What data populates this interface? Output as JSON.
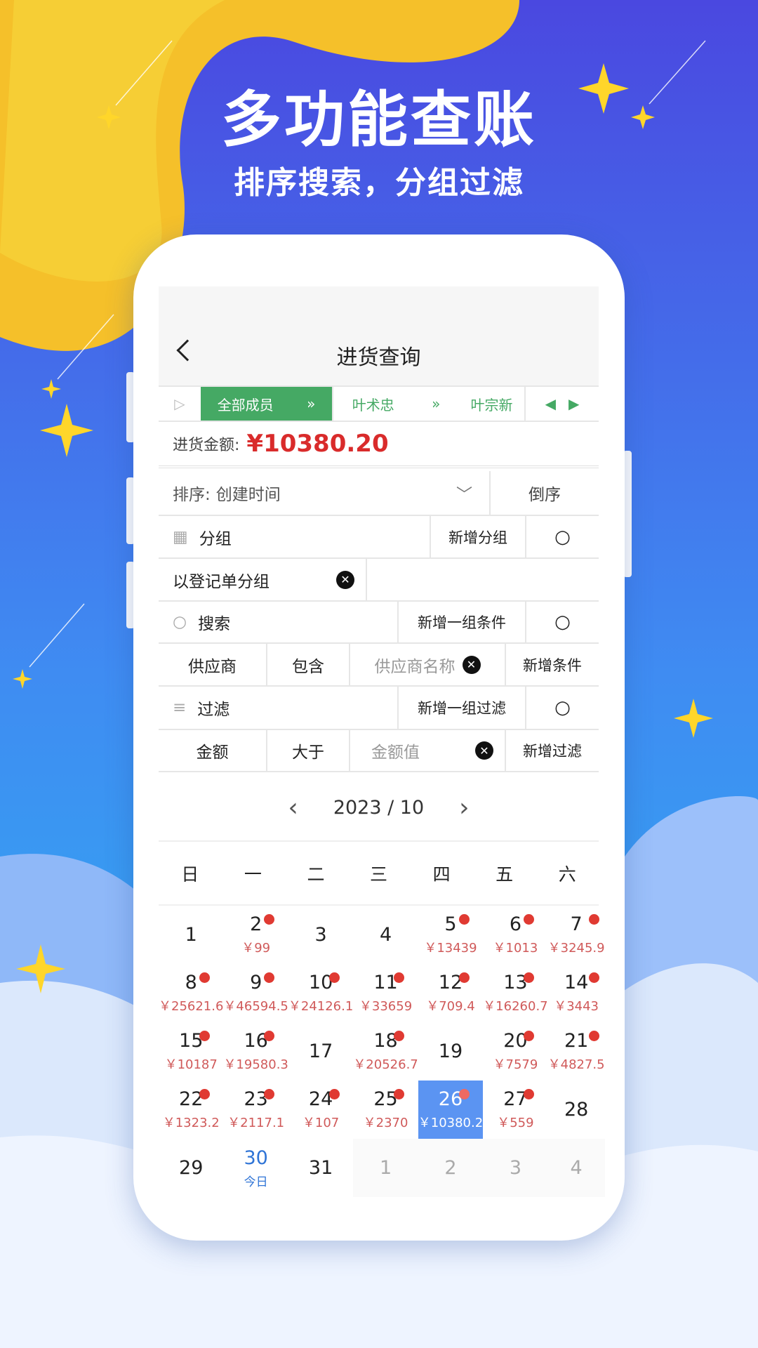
{
  "hero": {
    "title": "多功能查账",
    "subtitle": "排序搜索，分组过滤"
  },
  "colors": {
    "accent_green": "#45a964",
    "amount_red": "#d92b2b",
    "selected_blue": "#5b94f2",
    "today_blue": "#2f74d6"
  },
  "header": {
    "title": "进货查询",
    "back_icon": "chevron-left-icon"
  },
  "members": {
    "items": [
      "全部成员",
      "叶术忠",
      "叶宗新"
    ],
    "active": 0
  },
  "total": {
    "label": "进货金额:",
    "value": "¥10380.20"
  },
  "sort": {
    "label": "排序:",
    "value": "创建时间",
    "order": "倒序"
  },
  "group": {
    "label": "分组",
    "add": "新增分组",
    "tag": "以登记单分组"
  },
  "search": {
    "label": "搜索",
    "add": "新增一组条件",
    "field": "供应商",
    "op": "包含",
    "placeholder": "供应商名称",
    "add_cond": "新增条件"
  },
  "filter": {
    "label": "过滤",
    "add": "新增一组过滤",
    "field": "金额",
    "op": "大于",
    "placeholder": "金额值",
    "add_cond": "新增过滤"
  },
  "calendar": {
    "month": "2023 / 10",
    "weekdays": [
      "日",
      "一",
      "二",
      "三",
      "四",
      "五",
      "六"
    ],
    "today_label": "今日",
    "days": [
      {
        "n": "1"
      },
      {
        "n": "2",
        "a": "￥99"
      },
      {
        "n": "3"
      },
      {
        "n": "4"
      },
      {
        "n": "5",
        "a": "￥13439"
      },
      {
        "n": "6",
        "a": "￥1013"
      },
      {
        "n": "7",
        "a": "￥3245.9"
      },
      {
        "n": "8",
        "a": "￥25621.6"
      },
      {
        "n": "9",
        "a": "￥46594.5"
      },
      {
        "n": "10",
        "a": "￥24126.1"
      },
      {
        "n": "11",
        "a": "￥33659"
      },
      {
        "n": "12",
        "a": "￥709.4"
      },
      {
        "n": "13",
        "a": "￥16260.7"
      },
      {
        "n": "14",
        "a": "￥3443"
      },
      {
        "n": "15",
        "a": "￥10187"
      },
      {
        "n": "16",
        "a": "￥19580.3"
      },
      {
        "n": "17"
      },
      {
        "n": "18",
        "a": "￥20526.7"
      },
      {
        "n": "19"
      },
      {
        "n": "20",
        "a": "￥7579"
      },
      {
        "n": "21",
        "a": "￥4827.5"
      },
      {
        "n": "22",
        "a": "￥1323.2"
      },
      {
        "n": "23",
        "a": "￥2117.1"
      },
      {
        "n": "24",
        "a": "￥107"
      },
      {
        "n": "25",
        "a": "￥2370"
      },
      {
        "n": "26",
        "a": "￥10380.2",
        "selected": true
      },
      {
        "n": "27",
        "a": "￥559"
      },
      {
        "n": "28"
      },
      {
        "n": "29"
      },
      {
        "n": "30",
        "today": true
      },
      {
        "n": "31"
      },
      {
        "n": "1",
        "other": true
      },
      {
        "n": "2",
        "other": true
      },
      {
        "n": "3",
        "other": true
      },
      {
        "n": "4",
        "other": true
      }
    ]
  }
}
